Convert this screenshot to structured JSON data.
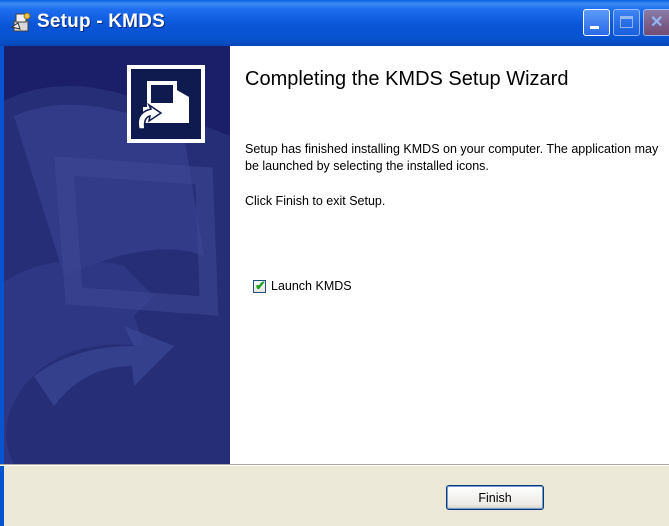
{
  "window": {
    "title": "Setup - KMDS",
    "title_icon": "setup-installer-icon",
    "controls": [
      "minimize-icon",
      "maximize-icon",
      "close-icon"
    ]
  },
  "wizard": {
    "heading": "Completing the KMDS Setup Wizard",
    "message": "Setup has finished installing KMDS on your computer. The application may be launched by selecting the installed icons.",
    "instruction": "Click Finish to exit Setup.",
    "launch_checkbox": {
      "label": "Launch KMDS",
      "checked": true
    },
    "side_logo_icon": "computer-installer-icon"
  },
  "buttons": {
    "finish_label": "Finish"
  },
  "colors": {
    "titlebar": "#0853cf",
    "sidebar": "#1b1f6a",
    "dialog_background": "#ece9d8",
    "check": "#21a121"
  }
}
